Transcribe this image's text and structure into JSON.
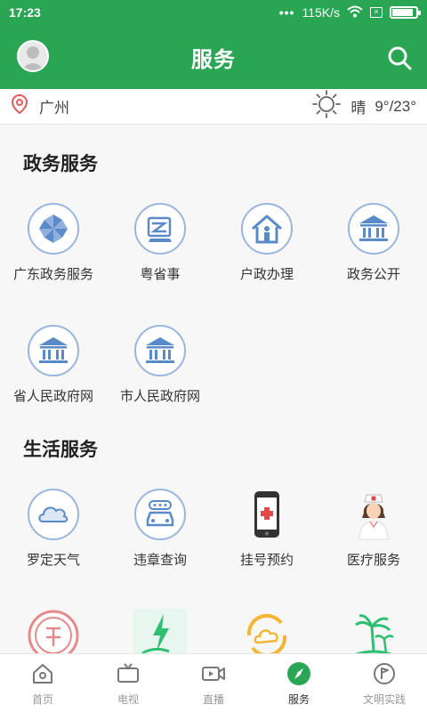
{
  "status_bar": {
    "time": "17:23",
    "dots": "•••",
    "speed": "115K/s",
    "battery_level": 0.9
  },
  "header": {
    "title": "服务"
  },
  "location_bar": {
    "city": "广州",
    "weather_condition": "晴",
    "temperature": "9°/23°"
  },
  "sections": {
    "government": {
      "title": "政务服务",
      "items": [
        {
          "label": "广东政务服务",
          "icon": "pinwheel-icon"
        },
        {
          "label": "粤省事",
          "icon": "document-icon"
        },
        {
          "label": "户政办理",
          "icon": "house-person-icon"
        },
        {
          "label": "政务公开",
          "icon": "government-building-icon"
        },
        {
          "label": "省人民政府网",
          "icon": "government-building-icon"
        },
        {
          "label": "市人民政府网",
          "icon": "government-building-icon"
        }
      ]
    },
    "life": {
      "title": "生活服务",
      "items": [
        {
          "label": "罗定天气",
          "icon": "cloud-icon"
        },
        {
          "label": "违章查询",
          "icon": "car-icon"
        },
        {
          "label": "挂号预约",
          "icon": "phone-medical-icon"
        },
        {
          "label": "医疗服务",
          "icon": "nurse-icon"
        }
      ]
    }
  },
  "tab_bar": {
    "items": [
      {
        "label": "首页",
        "icon": "home-icon"
      },
      {
        "label": "电视",
        "icon": "tv-icon"
      },
      {
        "label": "直播",
        "icon": "video-icon"
      },
      {
        "label": "服务",
        "icon": "compass-icon",
        "active": true
      },
      {
        "label": "文明实践",
        "icon": "flag-icon"
      }
    ]
  },
  "colors": {
    "brand_green": "#29a553",
    "icon_blue": "#5b8ac9",
    "icon_ring": "#9ab6de"
  }
}
